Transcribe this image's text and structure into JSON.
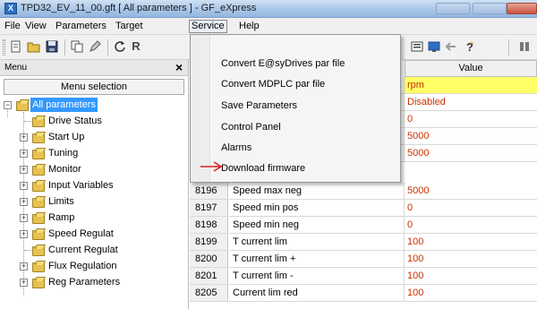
{
  "window": {
    "title": "TPD32_EV_11_00.gft [ All parameters ] - GF_eXpress",
    "app_icon_text": "X"
  },
  "menubar": {
    "items": [
      {
        "key": "file",
        "label": "File"
      },
      {
        "key": "view",
        "label": "View"
      },
      {
        "key": "parameters",
        "label": "Parameters"
      },
      {
        "key": "target",
        "label": "Target"
      },
      {
        "key": "service",
        "label": "Service"
      },
      {
        "key": "help",
        "label": "Help"
      }
    ],
    "active": "Service"
  },
  "toolbar": {
    "r_label": "R"
  },
  "service_menu": {
    "items": [
      "Convert E@syDrives par file",
      "Convert MDPLC par file",
      "Save Parameters",
      "Control Panel",
      "Alarms",
      "Download firmware"
    ],
    "highlight_color": "#e02020"
  },
  "left_panel": {
    "title": "Menu",
    "close_glyph": "×",
    "header": "Menu selection",
    "tree": [
      {
        "label": "All parameters",
        "level": 0,
        "expander": "−",
        "selected": true
      },
      {
        "label": "Drive Status",
        "level": 1,
        "expander": ""
      },
      {
        "label": "Start Up",
        "level": 1,
        "expander": "+"
      },
      {
        "label": "Tuning",
        "level": 1,
        "expander": "+"
      },
      {
        "label": "Monitor",
        "level": 1,
        "expander": "+"
      },
      {
        "label": "Input Variables",
        "level": 1,
        "expander": "+"
      },
      {
        "label": "Limits",
        "level": 1,
        "expander": "+"
      },
      {
        "label": "Ramp",
        "level": 1,
        "expander": "+"
      },
      {
        "label": "Speed Regulat",
        "level": 1,
        "expander": "+"
      },
      {
        "label": "Current Regulat",
        "level": 1,
        "expander": ""
      },
      {
        "label": "Flux Regulation",
        "level": 1,
        "expander": "+"
      },
      {
        "label": "Reg Parameters",
        "level": 1,
        "expander": "+"
      }
    ]
  },
  "grid": {
    "value_header": "Value",
    "rows": [
      {
        "id": "",
        "name": "",
        "value": "rpm",
        "highlight": true
      },
      {
        "id": "",
        "name": "",
        "value": "Disabled"
      },
      {
        "id": "",
        "name": "",
        "value": "0"
      },
      {
        "id": "",
        "name": "",
        "value": "5000"
      },
      {
        "id": "",
        "name": "",
        "value": "5000"
      },
      {
        "id": "8196",
        "name": "Speed max neg",
        "value": "5000"
      },
      {
        "id": "8197",
        "name": "Speed min pos",
        "value": "0"
      },
      {
        "id": "8198",
        "name": "Speed min neg",
        "value": "0"
      },
      {
        "id": "8199",
        "name": "T current lim",
        "value": "100"
      },
      {
        "id": "8200",
        "name": "T current lim +",
        "value": "100"
      },
      {
        "id": "8201",
        "name": "T current lim -",
        "value": "100"
      },
      {
        "id": "8205",
        "name": "Current lim red",
        "value": "100"
      }
    ]
  }
}
